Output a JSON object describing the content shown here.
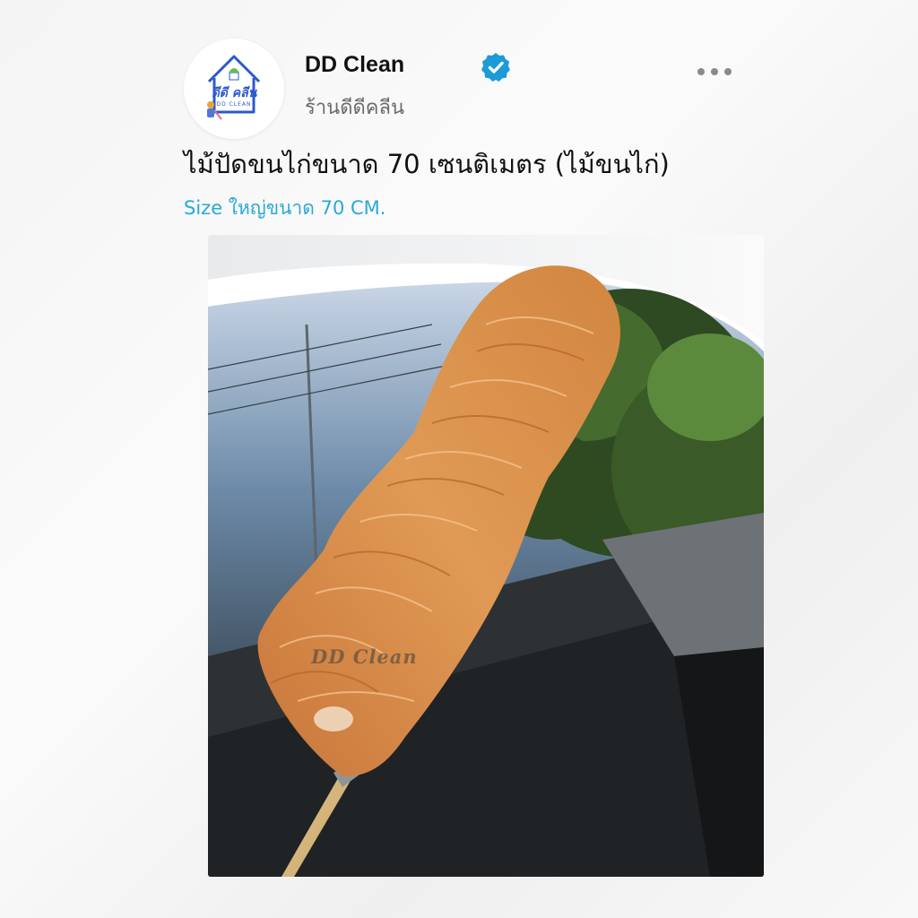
{
  "shop": {
    "name": "DD Clean",
    "handle": "ร้านดีดีคลีน",
    "logo_text": "ดีดี คลีน",
    "logo_subtext": "DD CLEAN",
    "verified": true
  },
  "post": {
    "title": "ไม้ปัดขนไก่ขนาด 70 เซนติเมตร (ไม้ขนไก่)",
    "subtitle": "Size ใหญ่ขนาด 70 CM."
  },
  "photo": {
    "watermark": "DD Clean"
  },
  "colors": {
    "verified_badge": "#1d9bd7",
    "subtitle": "#2aa8d8",
    "feather": "#d9893f",
    "brand_blue": "#2d59c9"
  },
  "icons": {
    "verified": "check-badge",
    "more": "ellipsis-horizontal"
  }
}
